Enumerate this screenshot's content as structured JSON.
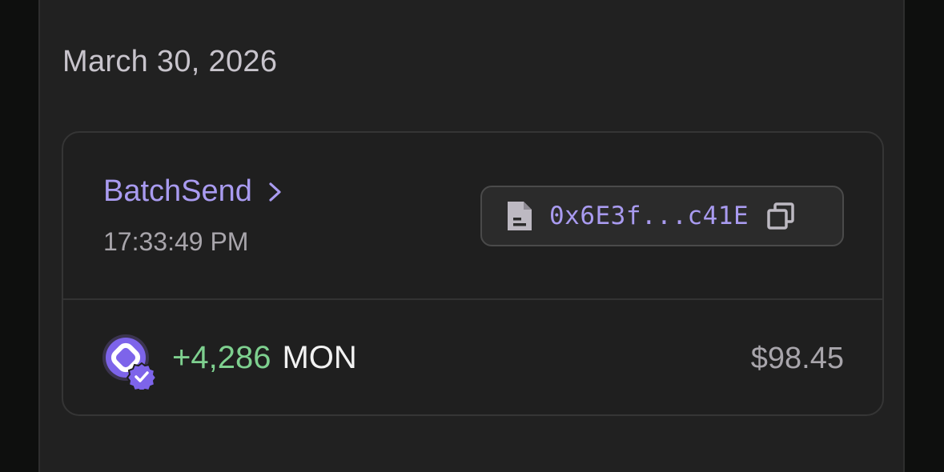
{
  "date_header": "March 30, 2026",
  "transaction": {
    "type_label": "BatchSend",
    "time": "17:33:49 PM",
    "address": "0x6E3f...c41E",
    "amount_change": "+4,286",
    "token_symbol": "MON",
    "fiat_value": "$98.45"
  },
  "icons": {
    "chevron": "chevron-right-icon",
    "document": "document-icon",
    "copy": "copy-icon",
    "token": "mon-token-icon",
    "verified": "verified-badge-icon"
  },
  "colors": {
    "accent": "#a99bf0",
    "positive": "#7ed08f",
    "background": "#212121"
  }
}
